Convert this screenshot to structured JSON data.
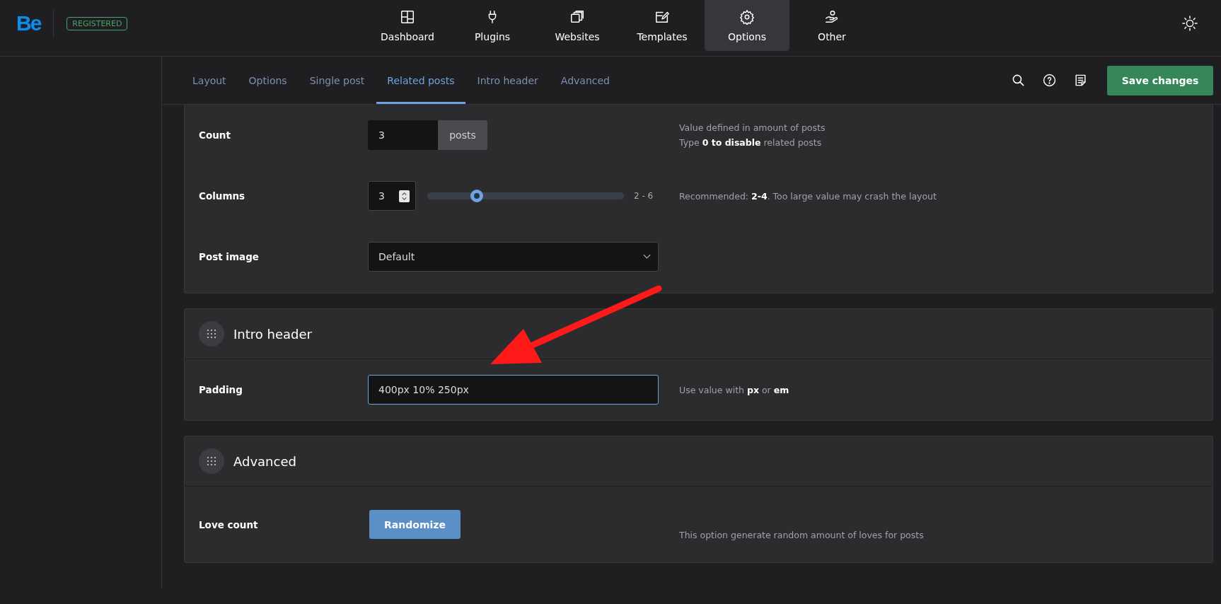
{
  "brand": {
    "logo": "Be",
    "badge": "REGISTERED"
  },
  "nav": [
    {
      "label": "Dashboard",
      "kind": "grid",
      "selected": false
    },
    {
      "label": "Plugins",
      "kind": "plug",
      "selected": false
    },
    {
      "label": "Websites",
      "kind": "copies",
      "selected": false
    },
    {
      "label": "Templates",
      "kind": "edit",
      "selected": false
    },
    {
      "label": "Options",
      "kind": "gear",
      "selected": true
    },
    {
      "label": "Other",
      "kind": "hand",
      "selected": false
    }
  ],
  "tabs": [
    {
      "label": "Layout",
      "selected": false
    },
    {
      "label": "Options",
      "selected": false
    },
    {
      "label": "Single post",
      "selected": false
    },
    {
      "label": "Related posts",
      "selected": true
    },
    {
      "label": "Intro header",
      "selected": false
    },
    {
      "label": "Advanced",
      "selected": false
    }
  ],
  "save_button": "Save changes",
  "sections": [
    {
      "rows": [
        {
          "kind": "number_unit",
          "label": "Count",
          "value": "3",
          "unit": "posts",
          "help": [
            "Value defined in amount of posts",
            "Type **0 to disable** related posts"
          ]
        },
        {
          "kind": "slider",
          "label": "Columns",
          "value": "3",
          "level": 0.25,
          "range": "2 - 6",
          "help": [
            "Recommended: **2-4**. Too large value may crash the layout"
          ]
        },
        {
          "kind": "select",
          "label": "Post image",
          "value": "Default"
        }
      ]
    },
    {
      "title": "Intro header",
      "rows": [
        {
          "kind": "text",
          "label": "Padding",
          "value": "400px 10% 250px",
          "focused": true,
          "help": [
            "Use value with **px** or **em**"
          ]
        }
      ]
    },
    {
      "title": "Advanced",
      "rows": [
        {
          "kind": "button",
          "label": "Love count",
          "button": "Randomize",
          "help": [
            "This option generate random amount of loves for posts"
          ]
        }
      ]
    }
  ]
}
